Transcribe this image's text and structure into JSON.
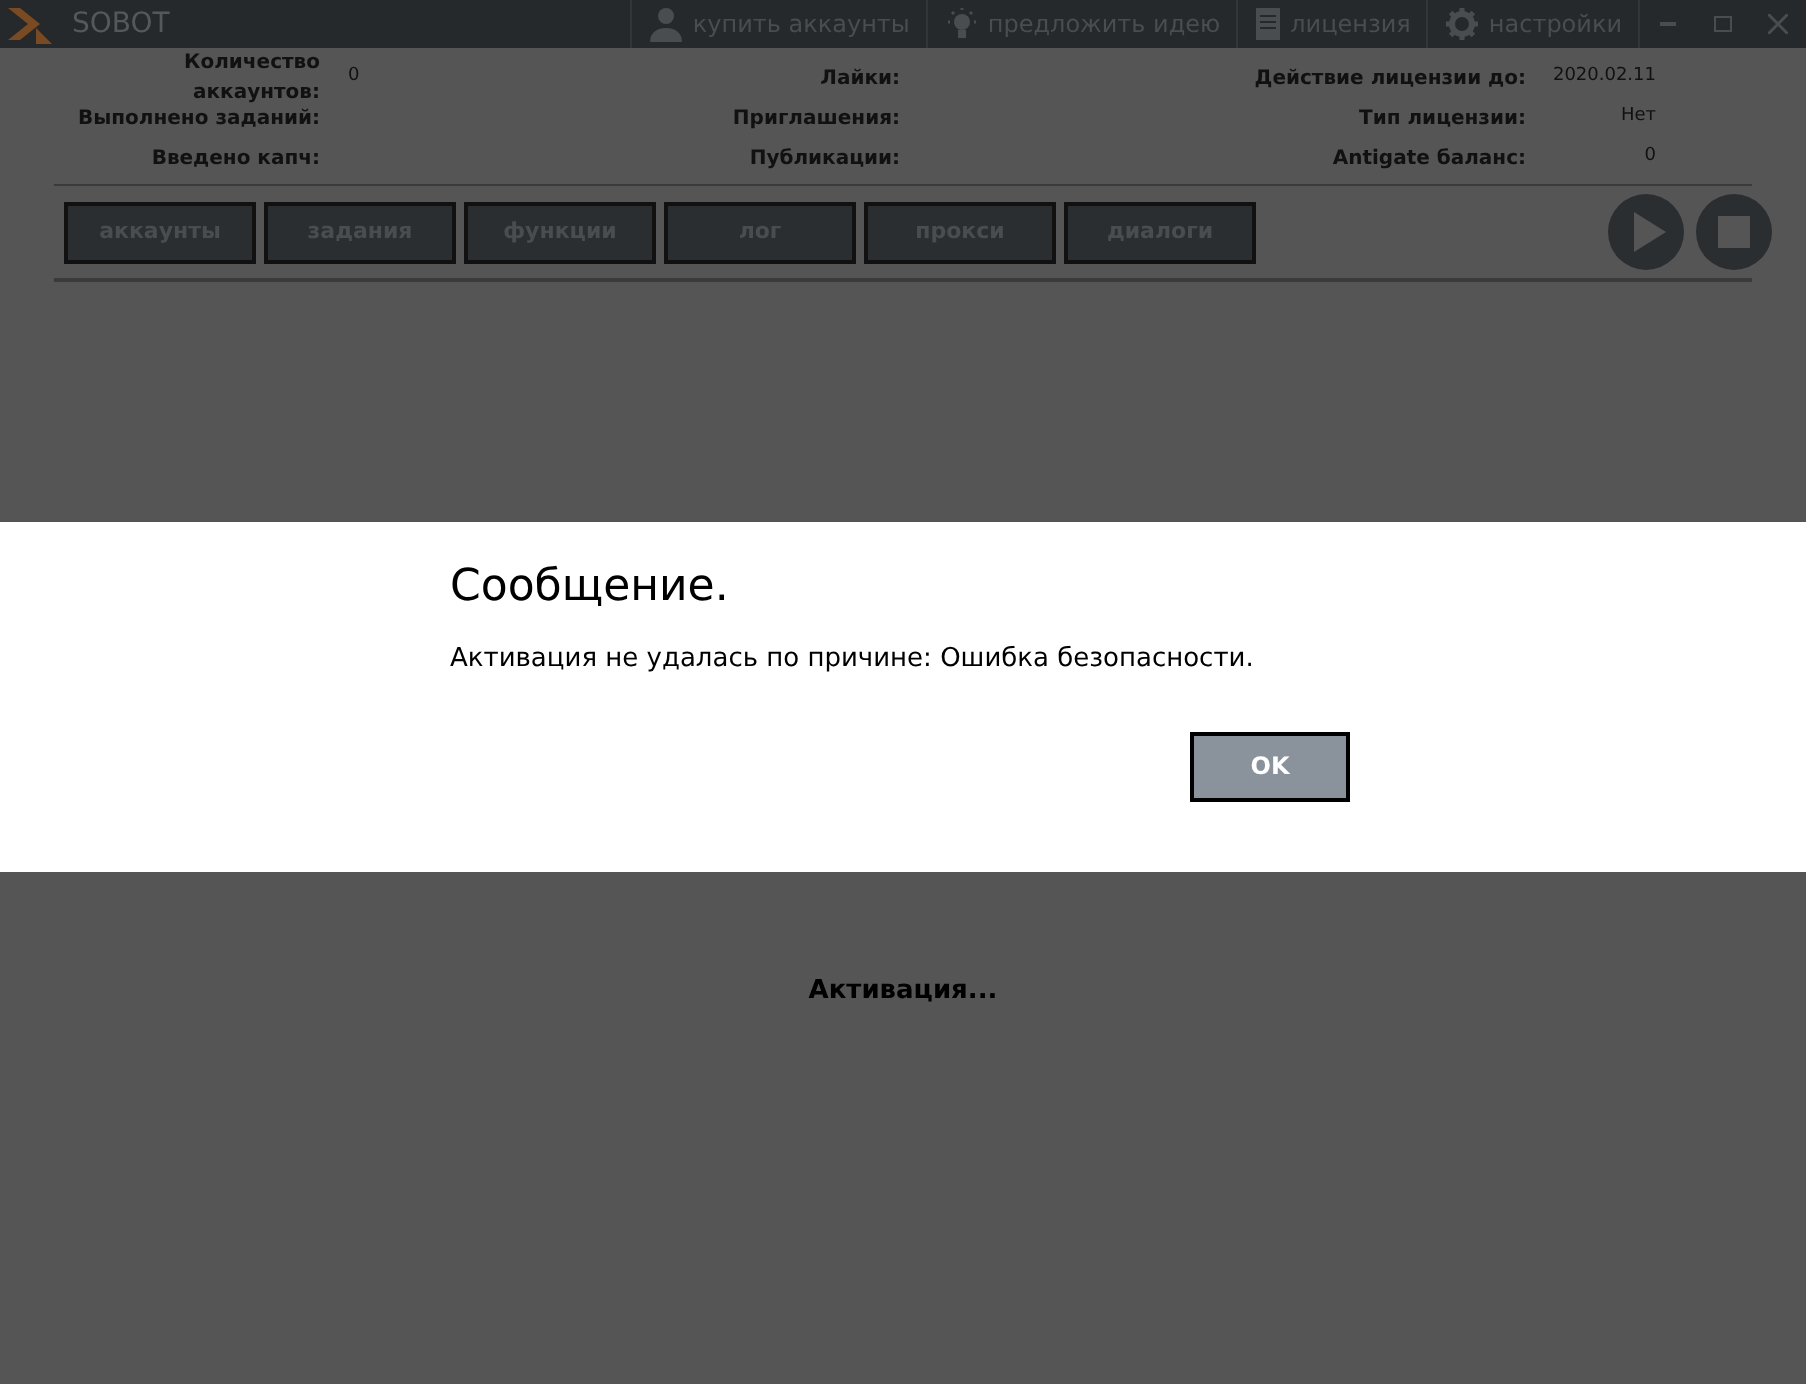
{
  "window": {
    "title": "SOBOT"
  },
  "menu": [
    {
      "kind": "user",
      "label": "купить аккаунты"
    },
    {
      "kind": "bulb",
      "label": "предложить идею"
    },
    {
      "kind": "doc",
      "label": "лицензия"
    },
    {
      "kind": "gear",
      "label": "настройки"
    }
  ],
  "stats": [
    [
      {
        "label": "Количество аккаунтов:",
        "value": "0"
      },
      {
        "label": "Выполнено заданий:"
      },
      {
        "label": "Введено капч:"
      }
    ],
    [
      {
        "label": "Лайки:"
      },
      {
        "label": "Приглашения:"
      },
      {
        "label": "Публикации:"
      }
    ],
    [
      {
        "label": "Действие лицензии до:",
        "value": "2020.02.11"
      },
      {
        "label": "Тип лицензии:",
        "value": "Нет"
      },
      {
        "label": "Antigate баланс:",
        "value": "0"
      }
    ]
  ],
  "tabs": [
    "аккаунты",
    "задания",
    "функции",
    "лог",
    "прокси",
    "диалоги"
  ],
  "dialog": {
    "title": "Сообщение.",
    "message": "Активация не удалась по причине: Ошибка безопасности.",
    "button": "OK"
  },
  "status": "Активация..."
}
